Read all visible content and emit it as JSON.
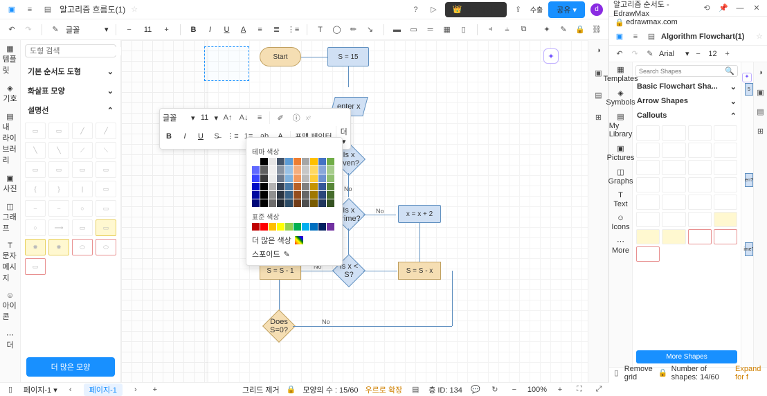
{
  "left": {
    "title": "알고리즘 흐름도(1)",
    "upgrade": "업그레이드",
    "export": "수출",
    "share": "공유",
    "avatar": "d",
    "font": "글꼴",
    "fontsize": "11",
    "searchPlaceholder": "도형 검색",
    "sections": {
      "basic": "기본 순서도 도형",
      "arrow": "화살표 모양",
      "callouts": "설명선"
    },
    "morebtn": "더 많은 모양",
    "floatFont": "글꼴",
    "floatSize": "11",
    "painter": "포맷 페인터",
    "more": "더",
    "colorTheme": "테마 색상",
    "colorStd": "표준 색상",
    "colorMore": "더 많은 색상",
    "eyedrop": "스포이드",
    "flow": {
      "start": "Start",
      "s15": "S = 15",
      "enterx": "enter x",
      "even": "Is x even?",
      "prime": "Is x prime?",
      "xplus2": "x = x + 2",
      "sminus1": "S = S - 1",
      "xlts": "Is x < S?",
      "sminusx": "S = S - x",
      "does0": "Does S=0?",
      "no": "No"
    },
    "status": {
      "pageTab": "페이지-1",
      "pageSel": "페이지-1",
      "grid": "그리드 제거",
      "shapes": "모양의 수 : 15/60",
      "free": "우르로 확장",
      "layer": "층 ID: 134",
      "zoom": "100%"
    }
  },
  "right": {
    "winTitle": "알고리즘 순서도 - EdrawMax",
    "url": "edrawmax.com",
    "docTitle": "Algorithm Flowchart(1)",
    "font": "Arial",
    "size": "12",
    "searchPh": "Search Shapes",
    "sect": {
      "basic": "Basic Flowchart Sha...",
      "arrow": "Arrow Shapes",
      "callouts": "Callouts"
    },
    "more": "More Shapes",
    "tabs": {
      "tmpl": "Templates",
      "sym": "Symbols",
      "lib": "My Library",
      "pic": "Pictures",
      "gr": "Graphs",
      "txt": "Text",
      "ic": "Icons",
      "mr": "More"
    },
    "status": {
      "grid": "Remove grid",
      "shapes": "Number of shapes: 14/60",
      "expand": "Expand for f"
    },
    "peek": {
      "s5": "5",
      "en": "en?",
      "ime": "ime?"
    }
  }
}
